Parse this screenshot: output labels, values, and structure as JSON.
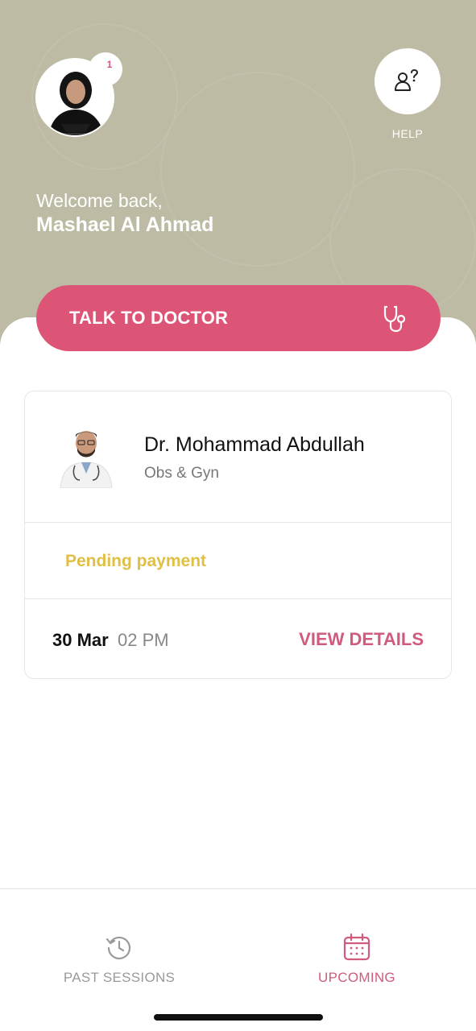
{
  "profile": {
    "notification_count": "1",
    "welcome_text": "Welcome back,",
    "user_name": "Mashael Al Ahmad"
  },
  "help": {
    "label": "HELP",
    "icon": "help-person-icon"
  },
  "talk_button": {
    "label": "TALK TO DOCTOR",
    "icon": "stethoscope-icon"
  },
  "appointment": {
    "doctor_name": "Dr. Mohammad Abdullah",
    "specialty": "Obs & Gyn",
    "status": "Pending payment",
    "date": "30 Mar",
    "time": "02 PM",
    "action_label": "VIEW DETAILS"
  },
  "bottom_nav": {
    "items": [
      {
        "label": "PAST SESSIONS",
        "icon": "history-icon",
        "active": false
      },
      {
        "label": "UPCOMING",
        "icon": "calendar-icon",
        "active": true
      }
    ]
  },
  "colors": {
    "header_bg": "#bdbba4",
    "accent": "#dd5576",
    "pending": "#e0bf45"
  }
}
